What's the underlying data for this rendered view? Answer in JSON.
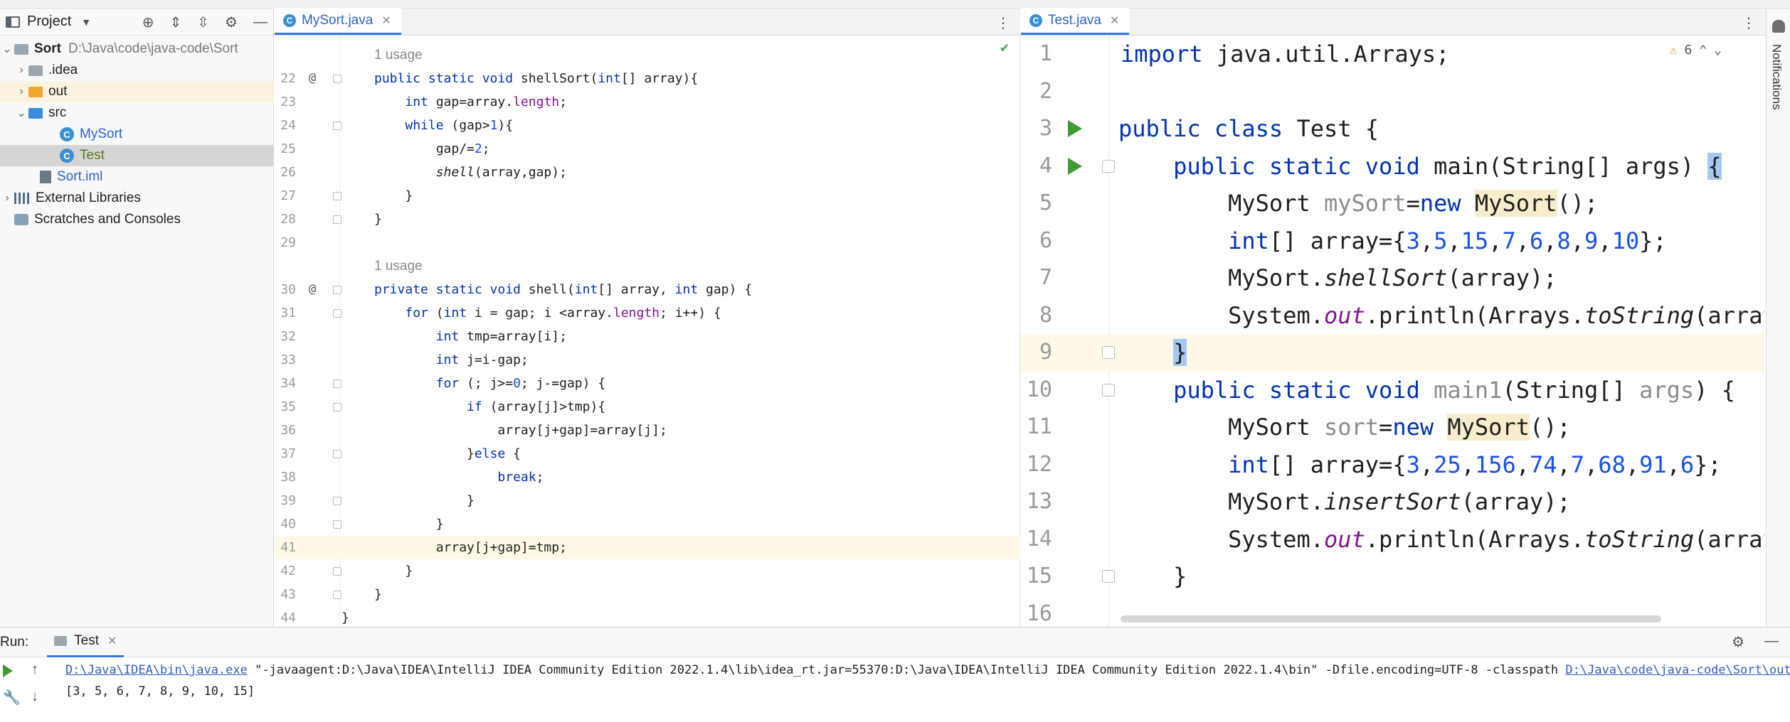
{
  "project": {
    "title": "Project",
    "tree": [
      {
        "label": "Sort",
        "hint": "D:\\Java\\code\\java-code\\Sort"
      },
      {
        "label": ".idea"
      },
      {
        "label": "out"
      },
      {
        "label": "src"
      },
      {
        "label": "MySort"
      },
      {
        "label": "Test"
      },
      {
        "label": "Sort.iml"
      },
      {
        "label": "External Libraries"
      },
      {
        "label": "Scratches and Consoles"
      }
    ]
  },
  "left_editor": {
    "tab": "MySort.java",
    "usage_1": "1 usage",
    "usage_2": "1 usage",
    "line_numbers": [
      "22",
      "23",
      "24",
      "25",
      "26",
      "27",
      "28",
      "29",
      "30",
      "31",
      "32",
      "33",
      "34",
      "35",
      "36",
      "37",
      "38",
      "39",
      "40",
      "41",
      "42",
      "43",
      "44"
    ]
  },
  "right_editor": {
    "tab": "Test.java",
    "warnings": "6",
    "line_numbers": [
      "1",
      "2",
      "3",
      "4",
      "5",
      "6",
      "7",
      "8",
      "9",
      "10",
      "11",
      "12",
      "13",
      "14",
      "15",
      "16"
    ]
  },
  "notifications": {
    "label": "Notifications"
  },
  "run": {
    "label": "Run:",
    "tab": "Test",
    "cmd_java": "D:\\Java\\IDEA\\bin\\java.exe",
    "cmd_args": " \"-javaagent:D:\\Java\\IDEA\\IntelliJ IDEA Community Edition 2022.1.4\\lib\\idea_rt.jar=55370:D:\\Java\\IDEA\\IntelliJ IDEA Community Edition 2022.1.4\\bin\" -Dfile.encoding=UTF-8 -classpath ",
    "cmd_classpath": "D:\\Java\\code\\java-code\\Sort\\out\\p",
    "output": "[3, 5, 6, 7, 8, 9, 10, 15]"
  },
  "colors": {
    "accent": "#3574f0",
    "keyword": "#0033b3",
    "field": "#871094",
    "number": "#1750eb",
    "run_green": "#3f9c35"
  }
}
